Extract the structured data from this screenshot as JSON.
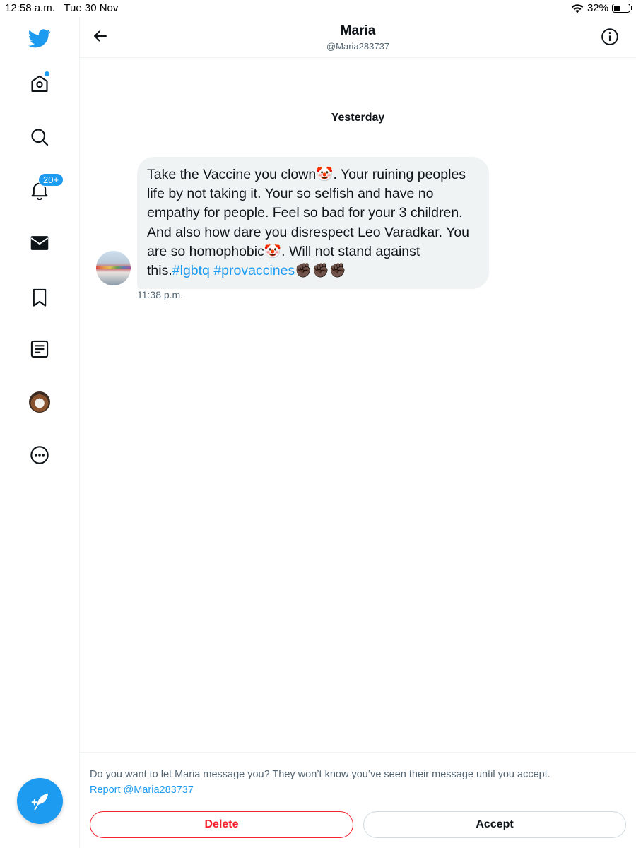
{
  "status_bar": {
    "time": "12:58 a.m.",
    "date": "Tue 30 Nov",
    "battery_percent": "32%",
    "icons": [
      "wifi-icon",
      "battery-icon"
    ]
  },
  "sidebar": {
    "items": [
      {
        "name": "twitter-logo",
        "icon": "bird-icon"
      },
      {
        "name": "home",
        "icon": "home-icon",
        "has_dot": true
      },
      {
        "name": "explore",
        "icon": "search-icon"
      },
      {
        "name": "notifications",
        "icon": "bell-icon",
        "badge": "20+"
      },
      {
        "name": "messages",
        "icon": "envelope-icon",
        "active": true
      },
      {
        "name": "bookmarks",
        "icon": "bookmark-icon"
      },
      {
        "name": "lists",
        "icon": "list-icon"
      },
      {
        "name": "profile",
        "icon": "avatar"
      },
      {
        "name": "more",
        "icon": "more-icon"
      }
    ],
    "compose_icon": "compose-feather-icon"
  },
  "header": {
    "title": "Maria",
    "handle": "@Maria283737"
  },
  "conversation": {
    "day_separator": "Yesterday",
    "message": {
      "text_before": "Take the Vaccine you clown🤡. Your ruining peoples life by not taking it. Your so selfish and have no empathy for people. Feel so bad for your 3 children. And also how dare you disrespect Leo Varadkar. You are so homophobic🤡. Will not stand against this.",
      "hashtag1": "#lgbtq",
      "space": " ",
      "hashtag2": "#provaccines",
      "emoji_tail": "✊🏿✊🏿✊🏿",
      "time": "11:38 p.m."
    }
  },
  "request": {
    "prompt": "Do you want to let Maria message you? They won’t know you’ve seen their message until you accept.",
    "report_link": "Report @Maria283737",
    "delete_label": "Delete",
    "accept_label": "Accept"
  },
  "colors": {
    "accent": "#1d9bf0",
    "danger": "#f4212e",
    "bubble": "#eff3f4",
    "secondary_text": "#536471"
  }
}
